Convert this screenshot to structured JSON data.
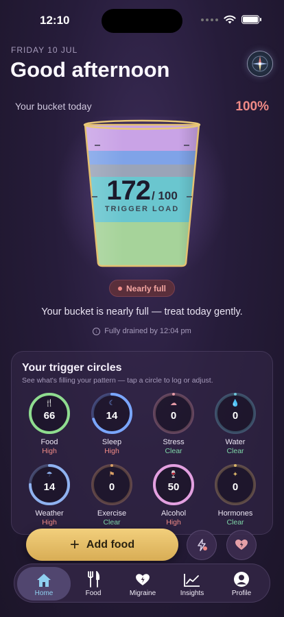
{
  "status": {
    "time": "12:10"
  },
  "header": {
    "date": "FRIDAY 10 JUL",
    "greeting": "Good afternoon",
    "compass_icon": "compass-icon"
  },
  "bucket": {
    "label": "Your bucket today",
    "percent_text": "100%",
    "fill_fraction": 1.0,
    "load_value": "172",
    "load_max": "/ 100",
    "load_label": "TRIGGER LOAD",
    "status_pill": "Nearly full",
    "message": "Your bucket is nearly full — treat today gently.",
    "drain_text": "Fully drained by 12:04 pm",
    "layer_colors": [
      "#c9a3e6",
      "#7fa3e8",
      "#9aa4b8",
      "#6ac6cf",
      "#a6d39a"
    ]
  },
  "circles": {
    "title": "Your trigger circles",
    "subtitle": "See what's filling your pattern — tap a circle to log or adjust.",
    "items": [
      {
        "name": "Food",
        "value": "66",
        "level": "High",
        "progress": 1.0,
        "color": "#8fdc8f",
        "icon": "fork-knife-icon"
      },
      {
        "name": "Sleep",
        "value": "14",
        "level": "High",
        "progress": 0.7,
        "color": "#7aa6ff",
        "icon": "moon-icon"
      },
      {
        "name": "Stress",
        "value": "0",
        "level": "Clear",
        "progress": 0.0,
        "color": "#e49aa6",
        "icon": "brain-icon"
      },
      {
        "name": "Water",
        "value": "0",
        "level": "Clear",
        "progress": 0.0,
        "color": "#6fc3d6",
        "icon": "water-drop-icon"
      },
      {
        "name": "Weather",
        "value": "14",
        "level": "High",
        "progress": 0.75,
        "color": "#8fb2f0",
        "icon": "cloud-rain-icon"
      },
      {
        "name": "Exercise",
        "value": "0",
        "level": "Clear",
        "progress": 0.0,
        "color": "#d9a066",
        "icon": "runner-icon"
      },
      {
        "name": "Alcohol",
        "value": "50",
        "level": "High",
        "progress": 1.0,
        "color": "#e3a0e0",
        "icon": "wine-glass-icon"
      },
      {
        "name": "Hormones",
        "value": "0",
        "level": "Clear",
        "progress": 0.0,
        "color": "#d9b46a",
        "icon": "sparkle-icon"
      }
    ]
  },
  "colors": {
    "high": "#f08a86",
    "clear": "#7fd6a8",
    "accent": "#f2cf7c"
  },
  "actions": {
    "add_food": "Add food"
  },
  "tabs": [
    {
      "label": "Home",
      "icon": "home-icon"
    },
    {
      "label": "Food",
      "icon": "fork-knife-icon"
    },
    {
      "label": "Migraine",
      "icon": "heart-bolt-icon"
    },
    {
      "label": "Insights",
      "icon": "chart-line-icon"
    },
    {
      "label": "Profile",
      "icon": "profile-icon"
    }
  ]
}
